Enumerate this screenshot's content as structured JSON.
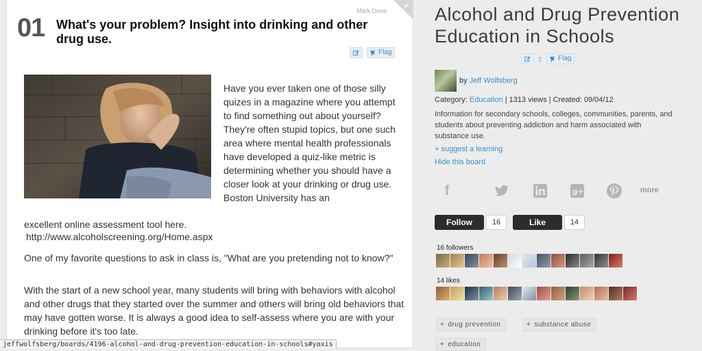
{
  "card": {
    "mark_done": "Mark Done",
    "number": "01",
    "title": "What's your problem? Insight into drinking and other drug use.",
    "edit_icon": "edit-icon",
    "flag_label": "Flag",
    "intro": "Have you ever taken one of those silly quizes in a magazine where you attempt to find something out about yourself?  They're often stupid topics, but one such area where mental health professionals have developed a quiz-like metric is determining whether you should have a closer look at your drinking or drug use.  Boston University has an",
    "intro_cont": "excellent online assessment tool here.",
    "url": "http://www.alcoholscreening.org/Home.aspx",
    "p2": "One of my favorite questions to ask in class is, \"What are you pretending not to know?\"",
    "p3": "With the start of a new school year, many students will bring with behaviors with alcohol and other drugs that they started over the summer and others will bring old behaviors that may have gotten worse.  It is always a good idea to self-assess where you are with your drinking before it's too late."
  },
  "statusbar": {
    "url": "jeffwolfsberg/boards/4196-alcohol-and-drug-prevention-education-in-schools#yaxis"
  },
  "board": {
    "title": "Alcohol and Drug Prevention Education in Schools",
    "flag_label": "Flag",
    "by": "by",
    "author": "Jeff Wolfsberg",
    "category_label": "Category:",
    "category": "Education",
    "views": "| 1313 views | Created: 09/04/12",
    "description": "Information for secondary schools, colleges, communities, parents, and students about preventing addiction and harm associated with substance use.",
    "suggest": "+ suggest a learning",
    "hide": "Hide this board",
    "more": "more",
    "follow_label": "Follow",
    "follow_count": "16",
    "like_label": "Like",
    "like_count": "14",
    "followers_label": "16 followers",
    "likes_label": "14 likes",
    "tags": [
      "drug prevention",
      "substance abuse",
      "education"
    ]
  },
  "social_icons": [
    "facebook-icon",
    "twitter-icon",
    "linkedin-icon",
    "google-plus-icon",
    "pinterest-icon"
  ],
  "colors": {
    "accent": "#3a8fc7",
    "button_dark": "#2c2c2c",
    "background": "#ececec"
  }
}
